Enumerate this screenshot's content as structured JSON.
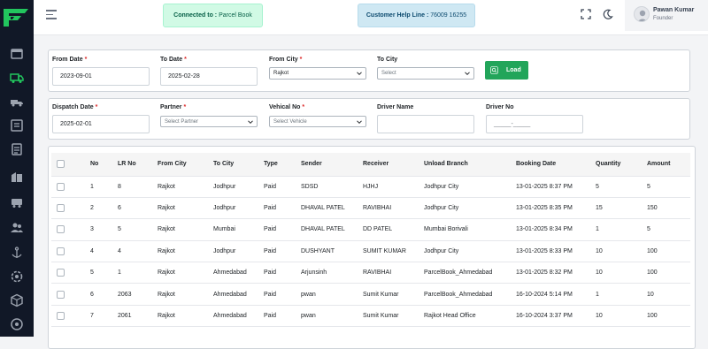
{
  "topbar": {
    "connected_label": "Connected to :",
    "connected_value": "Parcel Book",
    "helpline_label": "Customer Help Line :",
    "helpline_value": "76009 16255"
  },
  "profile": {
    "name": "Pawan Kumar",
    "role": "Founder"
  },
  "filters_row1": {
    "from_date": {
      "label": "From Date",
      "value": "2023-09-01"
    },
    "to_date": {
      "label": "To Date",
      "value": "2025-02-28"
    },
    "from_city": {
      "label": "From City",
      "value": "Rajkot"
    },
    "to_city": {
      "label": "To City",
      "placeholder": "Select"
    },
    "load_label": "Load"
  },
  "filters_row2": {
    "dispatch_date": {
      "label": "Dispatch Date",
      "value": "2025-02-01"
    },
    "partner": {
      "label": "Partner",
      "placeholder": "Select Partner"
    },
    "vehicle": {
      "label": "Vehical No",
      "placeholder": "Select Vehicle"
    },
    "driver_name": {
      "label": "Driver Name",
      "value": ""
    },
    "driver_no": {
      "label": "Driver No",
      "placeholder": "_____-_____"
    }
  },
  "table": {
    "headers": [
      "No",
      "LR No",
      "From City",
      "To City",
      "Type",
      "Sender",
      "Receiver",
      "Unload Branch",
      "Booking Date",
      "Quantity",
      "Amount"
    ],
    "rows": [
      [
        "1",
        "8",
        "Rajkot",
        "Jodhpur",
        "Paid",
        "SDSD",
        "HJHJ",
        "Jodhpur City",
        "13-01-2025 8:37 PM",
        "5",
        "5"
      ],
      [
        "2",
        "6",
        "Rajkot",
        "Jodhpur",
        "Paid",
        "DHAVAL PATEL",
        "RAVIBHAI",
        "Jodhpur City",
        "13-01-2025 8:35 PM",
        "15",
        "150"
      ],
      [
        "3",
        "5",
        "Rajkot",
        "Mumbai",
        "Paid",
        "DHAVAL PATEL",
        "DD PATEL",
        "Mumbai Borivali",
        "13-01-2025 8:34 PM",
        "1",
        "5"
      ],
      [
        "4",
        "4",
        "Rajkot",
        "Jodhpur",
        "Paid",
        "DUSHYANT",
        "SUMIT KUMAR",
        "Jodhpur City",
        "13-01-2025 8:33 PM",
        "10",
        "100"
      ],
      [
        "5",
        "1",
        "Rajkot",
        "Ahmedabad",
        "Paid",
        "Arjunsinh",
        "RAVIBHAI",
        "ParcelBook_Ahmedabad",
        "13-01-2025 8:32 PM",
        "10",
        "100"
      ],
      [
        "6",
        "2063",
        "Rajkot",
        "Ahmedabad",
        "Paid",
        "pwan",
        "Sumit Kumar",
        "ParcelBook_Ahmedabad",
        "16-10-2024 5:14 PM",
        "1",
        "10"
      ],
      [
        "7",
        "2061",
        "Rajkot",
        "Ahmedabad",
        "Paid",
        "pwan",
        "Sumit Kumar",
        "Rajkot Head Office",
        "16-10-2024 3:37 PM",
        "10",
        "100"
      ]
    ]
  },
  "colors": {
    "sidebar": "#111827",
    "accent": "#22a55a",
    "connected_bg": "#d1fae5",
    "helpline_bg": "#cfe8f3"
  },
  "icons": [
    "logo-icon",
    "dashboard-icon",
    "truck-icon",
    "delivery-icon",
    "booking-icon",
    "report-icon",
    "branch-icon",
    "vehicle-icon",
    "users-icon",
    "anchor-icon",
    "settings-icon",
    "box-icon",
    "help-icon",
    "menu-icon",
    "fullscreen-icon",
    "moon-icon",
    "user-icon",
    "search-icon",
    "chevron-down-icon"
  ]
}
